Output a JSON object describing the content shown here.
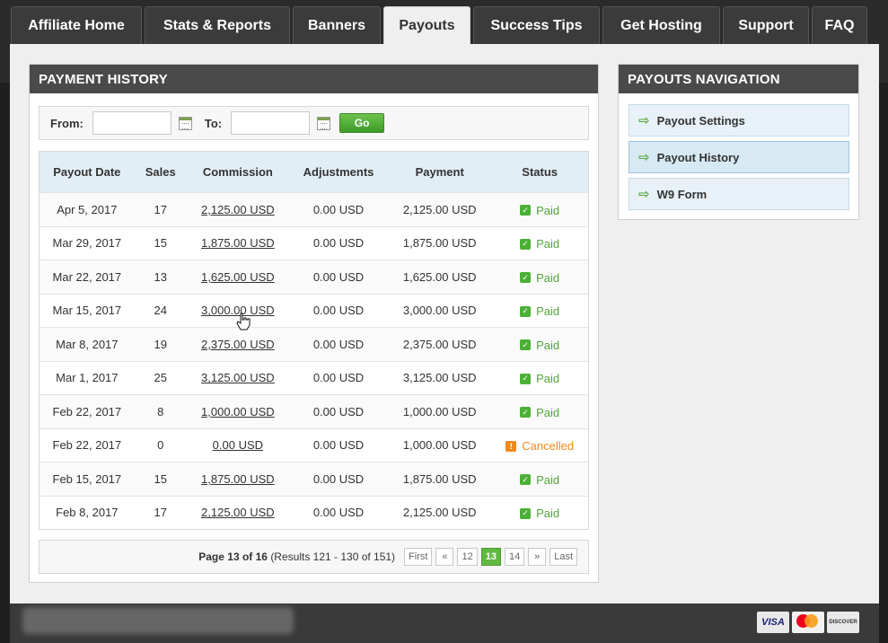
{
  "tabs": [
    {
      "label": "Affiliate Home",
      "active": false
    },
    {
      "label": "Stats & Reports",
      "active": false
    },
    {
      "label": "Banners",
      "active": false
    },
    {
      "label": "Payouts",
      "active": true
    },
    {
      "label": "Success Tips",
      "active": false
    },
    {
      "label": "Get Hosting",
      "active": false
    },
    {
      "label": "Support",
      "active": false
    },
    {
      "label": "FAQ",
      "active": false
    }
  ],
  "payment_history": {
    "title": "PAYMENT HISTORY",
    "filter": {
      "from_label": "From:",
      "to_label": "To:",
      "from_value": "",
      "to_value": "",
      "go_label": "Go"
    },
    "columns": [
      "Payout Date",
      "Sales",
      "Commission",
      "Adjustments",
      "Payment",
      "Status"
    ],
    "rows": [
      {
        "date": "Apr 5, 2017",
        "sales": "17",
        "commission": "2,125.00 USD",
        "adjustments": "0.00 USD",
        "payment": "2,125.00 USD",
        "status": "Paid"
      },
      {
        "date": "Mar 29, 2017",
        "sales": "15",
        "commission": "1,875.00 USD",
        "adjustments": "0.00 USD",
        "payment": "1,875.00 USD",
        "status": "Paid"
      },
      {
        "date": "Mar 22, 2017",
        "sales": "13",
        "commission": "1,625.00 USD",
        "adjustments": "0.00 USD",
        "payment": "1,625.00 USD",
        "status": "Paid"
      },
      {
        "date": "Mar 15, 2017",
        "sales": "24",
        "commission": "3,000.00 USD",
        "adjustments": "0.00 USD",
        "payment": "3,000.00 USD",
        "status": "Paid"
      },
      {
        "date": "Mar 8, 2017",
        "sales": "19",
        "commission": "2,375.00 USD",
        "adjustments": "0.00 USD",
        "payment": "2,375.00 USD",
        "status": "Paid"
      },
      {
        "date": "Mar 1, 2017",
        "sales": "25",
        "commission": "3,125.00 USD",
        "adjustments": "0.00 USD",
        "payment": "3,125.00 USD",
        "status": "Paid"
      },
      {
        "date": "Feb 22, 2017",
        "sales": "8",
        "commission": "1,000.00 USD",
        "adjustments": "0.00 USD",
        "payment": "1,000.00 USD",
        "status": "Paid"
      },
      {
        "date": "Feb 22, 2017",
        "sales": "0",
        "commission": "0.00 USD",
        "adjustments": "0.00 USD",
        "payment": "1,000.00 USD",
        "status": "Cancelled"
      },
      {
        "date": "Feb 15, 2017",
        "sales": "15",
        "commission": "1,875.00 USD",
        "adjustments": "0.00 USD",
        "payment": "1,875.00 USD",
        "status": "Paid"
      },
      {
        "date": "Feb 8, 2017",
        "sales": "17",
        "commission": "2,125.00 USD",
        "adjustments": "0.00 USD",
        "payment": "2,125.00 USD",
        "status": "Paid"
      }
    ],
    "pagination": {
      "page_text": "Page 13 of 16",
      "results_text": "(Results 121 - 130 of 151)",
      "first": "First",
      "prev": "«",
      "pages": [
        "12",
        "13",
        "14"
      ],
      "current": "13",
      "next": "»",
      "last": "Last"
    }
  },
  "payouts_nav": {
    "title": "PAYOUTS NAVIGATION",
    "items": [
      {
        "label": "Payout Settings",
        "active": false
      },
      {
        "label": "Payout History",
        "active": true
      },
      {
        "label": "W9 Form",
        "active": false
      }
    ]
  },
  "footer": {
    "cards": [
      "VISA",
      "MasterCard",
      "DISCOVER"
    ]
  },
  "colors": {
    "accent_green": "#5fb83f",
    "paid": "#52a53a",
    "cancelled": "#f08a1c",
    "header_dark": "#4a4a4a"
  }
}
